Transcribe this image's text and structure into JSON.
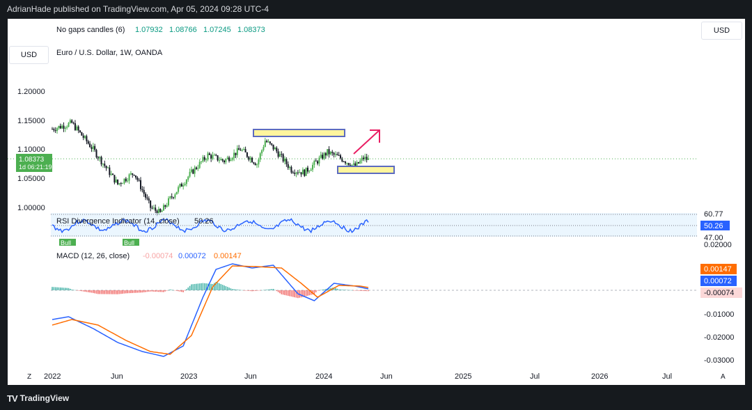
{
  "header": {
    "publisher_line": "AdrianHade published on TradingView.com, Apr 05, 2024 09:28 UTC-4"
  },
  "footer": {
    "brand": "TradingView"
  },
  "buttons": {
    "currency_right": "USD",
    "currency_left": "USD"
  },
  "legend": {
    "indicator_name": "No gaps candles (6)",
    "open": "1.07932",
    "high": "1.08766",
    "low": "1.07245",
    "close": "1.08373",
    "symbol": "Euro / U.S. Dollar, 1W, OANDA"
  },
  "price_axis": {
    "ticks": [
      "1.20000",
      "1.15000",
      "1.10000",
      "1.05000",
      "1.00000"
    ],
    "current_price": "1.08373",
    "countdown": "1d 06:21:19"
  },
  "rsi": {
    "label": "RSI Divergence Indicator (14, close)",
    "value": "50.26",
    "upper": "60.77",
    "lower": "47.00",
    "bull_badge": "Bull"
  },
  "macd": {
    "label": "MACD (12, 26, close)",
    "hist": "-0.00074",
    "macd": "0.00072",
    "signal": "0.00147",
    "ticks": [
      "0.02000",
      "-0.01000",
      "-0.02000",
      "-0.03000"
    ]
  },
  "time_axis": [
    "2022",
    "Jun",
    "2023",
    "Jun",
    "2024",
    "Jun",
    "2025",
    "Jul",
    "2026",
    "Jul"
  ],
  "colors": {
    "up": "#26a69a",
    "candle_up": "#4caf50",
    "candle_down": "#131722",
    "macd": "#2962ff",
    "signal": "#ff6d00",
    "rsi": "#2962ff",
    "box_fill": "#fff59d",
    "box_stroke": "#5c6bc0",
    "arrow": "#e91e63"
  },
  "chart_data": {
    "type": "line",
    "title": "Euro / U.S. Dollar, 1W, OANDA",
    "x": [
      "2022-01",
      "2022-03",
      "2022-06",
      "2022-09",
      "2022-12",
      "2023-03",
      "2023-07",
      "2023-10",
      "2024-01",
      "2024-04"
    ],
    "series": [
      {
        "name": "No gaps candles",
        "values": [
          1.13,
          1.15,
          1.05,
          0.99,
          1.06,
          1.09,
          1.12,
          1.05,
          1.11,
          1.08
        ]
      }
    ],
    "ylim": [
      0.98,
      1.22
    ]
  }
}
